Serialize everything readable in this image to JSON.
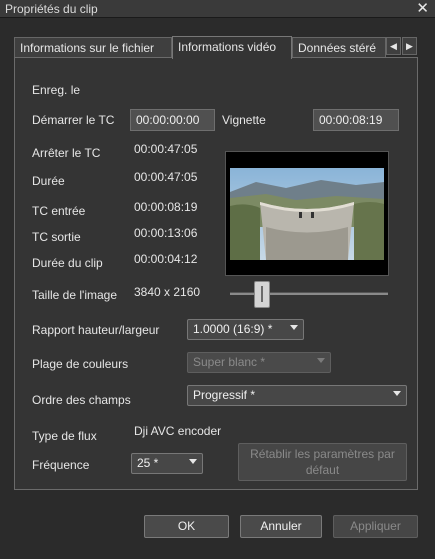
{
  "window": {
    "title": "Propriétés du clip"
  },
  "tabs": [
    {
      "label": "Informations sur le fichier"
    },
    {
      "label": "Informations vidéo"
    },
    {
      "label": "Données stéré"
    }
  ],
  "labels": {
    "enreg": "Enreg. le",
    "start_tc": "Démarrer le TC",
    "thumbnail": "Vignette",
    "stop_tc": "Arrêter le TC",
    "duration": "Durée",
    "tc_in": "TC entrée",
    "tc_out": "TC sortie",
    "clip_duration": "Durée du clip",
    "image_size": "Taille de l'image",
    "aspect_ratio": "Rapport hauteur/largeur",
    "color_range": "Plage de couleurs",
    "field_order": "Ordre des champs",
    "stream_type": "Type de flux",
    "frequency": "Fréquence"
  },
  "values": {
    "start_tc": "00:00:00:00",
    "thumbnail_tc": "00:00:08:19",
    "stop_tc": "00:00:47:05",
    "duration": "00:00:47:05",
    "tc_in": "00:00:08:19",
    "tc_out": "00:00:13:06",
    "clip_duration": "00:00:04:12",
    "image_size": "3840 x 2160",
    "stream_type": "Dji AVC encoder"
  },
  "selects": {
    "aspect_ratio": "1.0000 (16:9) *",
    "color_range": "Super blanc *",
    "field_order": "Progressif *",
    "frequency": "25 *"
  },
  "buttons": {
    "reset_defaults": "Rétablir les paramètres par défaut",
    "ok": "OK",
    "cancel": "Annuler",
    "apply": "Appliquer"
  },
  "colors": {
    "background": "#2b2b2b",
    "panel": "#343434",
    "field": "#505050"
  }
}
